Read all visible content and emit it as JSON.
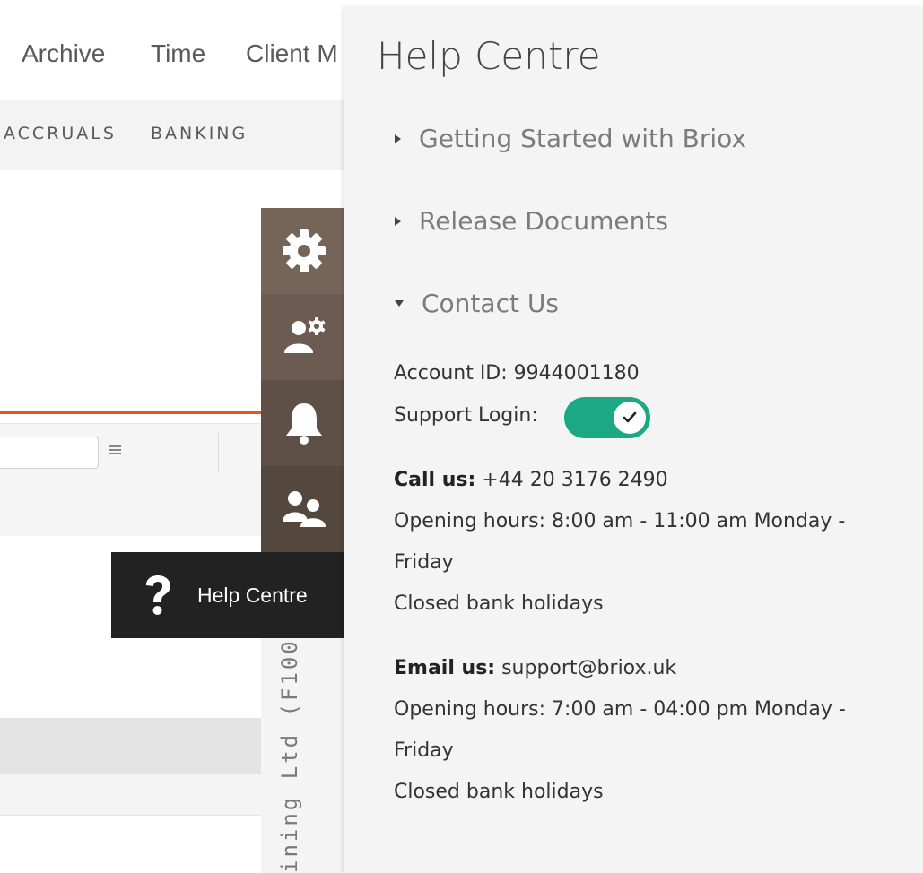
{
  "topnav": {
    "items": [
      "Archive",
      "Time",
      "Client M"
    ]
  },
  "subnav": {
    "items": [
      "ACCRUALS",
      "BANKING"
    ]
  },
  "toolbar": {
    "items": [
      {
        "icon": "gear-icon",
        "bg": "#756559"
      },
      {
        "icon": "user-settings-icon",
        "bg": "#6b5b50"
      },
      {
        "icon": "bell-icon",
        "bg": "#5e5047"
      },
      {
        "icon": "users-icon",
        "bg": "#54473e"
      }
    ],
    "company_vertical": "ining Ltd (F100)"
  },
  "help_button": {
    "label": "Help Centre"
  },
  "help_panel": {
    "title": "Help Centre",
    "sections": [
      {
        "label": "Getting Started with Briox",
        "expanded": false
      },
      {
        "label": "Release Documents",
        "expanded": false
      },
      {
        "label": "Contact Us",
        "expanded": true
      }
    ],
    "account_id": "Account ID: 9944001180",
    "support_login_label": "Support Login:",
    "support_login_enabled": true,
    "call": {
      "label": "Call us:",
      "value": " +44 20 3176 2490",
      "hours_line1": "Opening hours: 8:00 am - 11:00 am Monday -",
      "hours_line2": "Friday",
      "closed": "Closed bank holidays"
    },
    "email": {
      "label": "Email us:",
      "value": " support@briox.uk",
      "hours_line1": "Opening hours: 7:00 am - 04:00 pm Monday -",
      "hours_line2": "Friday",
      "closed": "Closed bank holidays"
    }
  },
  "colors": {
    "accent_orange": "#e8541e",
    "toggle_green": "#1aa885",
    "dark": "#222222"
  }
}
